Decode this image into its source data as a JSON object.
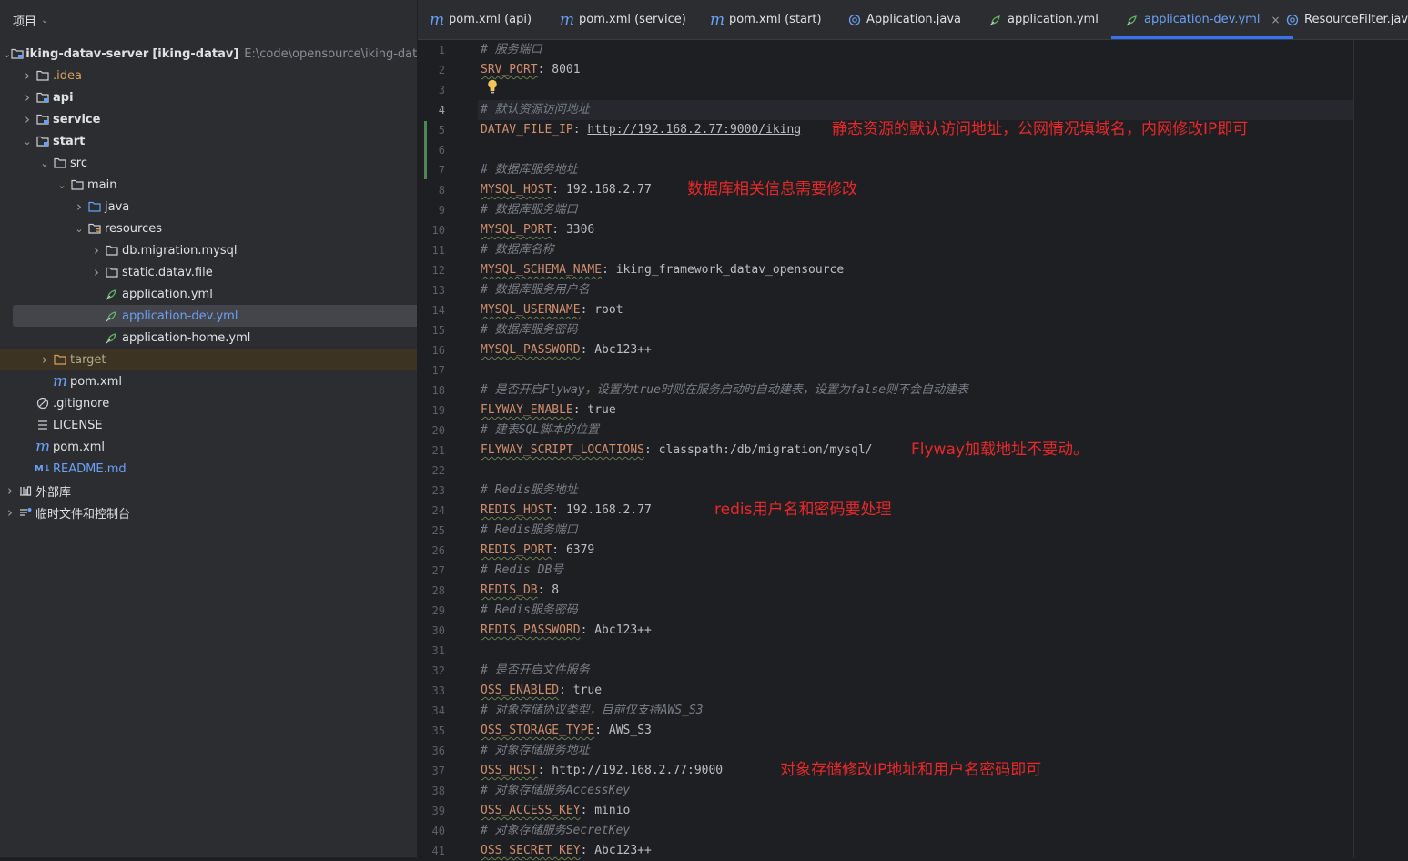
{
  "project_panel": {
    "title": "项目",
    "tree": [
      {
        "label": "iking-datav-server",
        "tag": "[iking-datav]",
        "path": "E:\\code\\opensource\\iking-datav-serv",
        "icon": "module-folder-icon",
        "depth": 0,
        "arrow": "v",
        "style": "",
        "name": "root"
      },
      {
        "label": ".idea",
        "icon": "folder-icon",
        "depth": 1,
        "arrow": ">",
        "style": "orange",
        "name": "idea"
      },
      {
        "label": "api",
        "icon": "module-folder-icon",
        "depth": 1,
        "arrow": ">",
        "style": "bold",
        "name": "api"
      },
      {
        "label": "service",
        "icon": "module-folder-icon",
        "depth": 1,
        "arrow": ">",
        "style": "bold",
        "name": "service"
      },
      {
        "label": "start",
        "icon": "module-folder-icon",
        "depth": 1,
        "arrow": "v",
        "style": "bold",
        "name": "start"
      },
      {
        "label": "src",
        "icon": "folder-icon",
        "depth": 2,
        "arrow": "v",
        "style": "",
        "name": "src"
      },
      {
        "label": "main",
        "icon": "folder-icon",
        "depth": 3,
        "arrow": "v",
        "style": "",
        "name": "main"
      },
      {
        "label": "java",
        "icon": "source-folder-icon",
        "depth": 4,
        "arrow": ">",
        "style": "",
        "name": "java"
      },
      {
        "label": "resources",
        "icon": "resources-folder-icon",
        "depth": 4,
        "arrow": "v",
        "style": "",
        "name": "resources"
      },
      {
        "label": "db.migration.mysql",
        "icon": "folder-icon",
        "depth": 5,
        "arrow": ">",
        "style": "",
        "name": "db-migration"
      },
      {
        "label": "static.datav.file",
        "icon": "folder-icon",
        "depth": 5,
        "arrow": ">",
        "style": "",
        "name": "static-datav"
      },
      {
        "label": "application.yml",
        "icon": "yaml-file-icon",
        "depth": 5,
        "arrow": "",
        "style": "",
        "name": "application-yml"
      },
      {
        "label": "application-dev.yml",
        "icon": "yaml-file-icon",
        "depth": 5,
        "arrow": "",
        "style": "blue",
        "selected": true,
        "name": "application-dev-yml"
      },
      {
        "label": "application-home.yml",
        "icon": "yaml-file-icon",
        "depth": 5,
        "arrow": "",
        "style": "",
        "name": "application-home-yml"
      },
      {
        "label": "target",
        "icon": "excluded-folder-icon",
        "depth": 2,
        "arrow": ">",
        "style": "tan",
        "excluded": true,
        "name": "target"
      },
      {
        "label": "pom.xml",
        "icon": "maven-icon",
        "depth": 2,
        "arrow": "",
        "style": "",
        "name": "start-pom"
      },
      {
        "label": ".gitignore",
        "icon": "ignore-file-icon",
        "depth": 1,
        "arrow": "",
        "style": "",
        "name": "gitignore"
      },
      {
        "label": "LICENSE",
        "icon": "text-file-icon",
        "depth": 1,
        "arrow": "",
        "style": "",
        "name": "license"
      },
      {
        "label": "pom.xml",
        "icon": "maven-icon",
        "depth": 1,
        "arrow": "",
        "style": "",
        "name": "root-pom"
      },
      {
        "label": "README.md",
        "icon": "markdown-icon",
        "depth": 1,
        "arrow": "",
        "style": "blue",
        "name": "readme"
      },
      {
        "label": "外部库",
        "icon": "library-icon",
        "depth": 0,
        "arrow": ">",
        "style": "",
        "name": "external-libraries"
      },
      {
        "label": "临时文件和控制台",
        "icon": "scratches-icon",
        "depth": 0,
        "arrow": ">",
        "style": "",
        "name": "scratches"
      }
    ]
  },
  "tabs": [
    {
      "label": "pom.xml (api)",
      "icon": "maven-icon",
      "glyph": "m",
      "active": false
    },
    {
      "label": "pom.xml (service)",
      "icon": "maven-icon",
      "glyph": "m",
      "active": false
    },
    {
      "label": "pom.xml (start)",
      "icon": "maven-icon",
      "glyph": "m",
      "active": false
    },
    {
      "label": "Application.java",
      "icon": "java-class-icon",
      "glyph": "◎",
      "active": false
    },
    {
      "label": "application.yml",
      "icon": "yaml-file-icon",
      "glyph": "",
      "active": false
    },
    {
      "label": "application-dev.yml",
      "icon": "yaml-file-icon",
      "glyph": "",
      "active": true,
      "closable": true
    },
    {
      "label": "ResourceFilter.java",
      "icon": "java-class-icon",
      "glyph": "◎",
      "active": false
    }
  ],
  "editor": {
    "current_line": 4,
    "lines": [
      {
        "n": "1",
        "type": "comment",
        "text": "# 服务端口"
      },
      {
        "n": "2",
        "type": "kv",
        "key": "SRV_PORT",
        "value": "8001"
      },
      {
        "n": "3",
        "type": "blank"
      },
      {
        "n": "4",
        "type": "comment",
        "text": "# 默认资源访问地址"
      },
      {
        "n": "5",
        "type": "kv",
        "key": "DATAV_FILE_IP",
        "value": "http://192.168.2.77:9000/iking",
        "url": true,
        "plainkey": true
      },
      {
        "n": "6",
        "type": "blank"
      },
      {
        "n": "7",
        "type": "comment",
        "text": "# 数据库服务地址"
      },
      {
        "n": "8",
        "type": "kv",
        "key": "MYSQL_HOST",
        "value": "192.168.2.77"
      },
      {
        "n": "9",
        "type": "comment",
        "text": "# 数据库服务端口"
      },
      {
        "n": "10",
        "type": "kv",
        "key": "MYSQL_PORT",
        "value": "3306"
      },
      {
        "n": "11",
        "type": "comment",
        "text": "# 数据库名称"
      },
      {
        "n": "12",
        "type": "kv",
        "key": "MYSQL_SCHEMA_NAME",
        "value": "iking_framework_datav_opensource"
      },
      {
        "n": "13",
        "type": "comment",
        "text": "# 数据库服务用户名"
      },
      {
        "n": "14",
        "type": "kv",
        "key": "MYSQL_USERNAME",
        "value": "root"
      },
      {
        "n": "15",
        "type": "comment",
        "text": "# 数据库服务密码"
      },
      {
        "n": "16",
        "type": "kv",
        "key": "MYSQL_PASSWORD",
        "value": "Abc123++"
      },
      {
        "n": "17",
        "type": "blank"
      },
      {
        "n": "18",
        "type": "comment",
        "text": "# 是否开启Flyway，设置为true时则在服务启动时自动建表，设置为false则不会自动建表"
      },
      {
        "n": "19",
        "type": "kv",
        "key": "FLYWAY_ENABLE",
        "value": "true"
      },
      {
        "n": "20",
        "type": "comment",
        "text": "# 建表SQL脚本的位置"
      },
      {
        "n": "21",
        "type": "kv",
        "key": "FLYWAY_SCRIPT_LOCATIONS",
        "value": "classpath:/db/migration/mysql/"
      },
      {
        "n": "22",
        "type": "blank"
      },
      {
        "n": "23",
        "type": "comment",
        "text": "# Redis服务地址"
      },
      {
        "n": "24",
        "type": "kv",
        "key": "REDIS_HOST",
        "value": "192.168.2.77"
      },
      {
        "n": "25",
        "type": "comment",
        "text": "# Redis服务端口"
      },
      {
        "n": "26",
        "type": "kv",
        "key": "REDIS_PORT",
        "value": "6379"
      },
      {
        "n": "27",
        "type": "comment",
        "text": "# Redis DB号"
      },
      {
        "n": "28",
        "type": "kv",
        "key": "REDIS_DB",
        "value": "8"
      },
      {
        "n": "29",
        "type": "comment",
        "text": "# Redis服务密码"
      },
      {
        "n": "30",
        "type": "kv",
        "key": "REDIS_PASSWORD",
        "value": "Abc123++"
      },
      {
        "n": "31",
        "type": "blank"
      },
      {
        "n": "32",
        "type": "comment",
        "text": "# 是否开启文件服务"
      },
      {
        "n": "33",
        "type": "kv",
        "key": "OSS_ENABLED",
        "value": "true"
      },
      {
        "n": "34",
        "type": "comment",
        "text": "# 对象存储协议类型，目前仅支持AWS_S3"
      },
      {
        "n": "35",
        "type": "kv",
        "key": "OSS_STORAGE_TYPE",
        "value": "AWS_S3"
      },
      {
        "n": "36",
        "type": "comment",
        "text": "# 对象存储服务地址"
      },
      {
        "n": "37",
        "type": "kv",
        "key": "OSS_HOST",
        "value": "http://192.168.2.77:9000",
        "url": true
      },
      {
        "n": "38",
        "type": "comment",
        "text": "# 对象存储服务AccessKey"
      },
      {
        "n": "39",
        "type": "kv",
        "key": "OSS_ACCESS_KEY",
        "value": "minio"
      },
      {
        "n": "40",
        "type": "comment",
        "text": "# 对象存储服务SecretKey"
      },
      {
        "n": "41",
        "type": "kv",
        "key": "OSS_SECRET_KEY",
        "value": "Abc123++"
      }
    ]
  },
  "annotations": [
    {
      "text": "静态资源的默认访问地址，公网情况填域名，内网修改IP即可",
      "line": 5,
      "col": 389
    },
    {
      "text": "数据库相关信息需要修改",
      "line": 8,
      "col": 230
    },
    {
      "text": "Flyway加载地址不要动。",
      "line": 21,
      "col": 476
    },
    {
      "text": "redis用户名和密码要处理",
      "line": 24,
      "col": 260
    },
    {
      "text": "对象存储修改IP地址和用户名密码即可",
      "line": 37,
      "col": 332
    }
  ],
  "colors": {
    "annotation": "#e8282b",
    "key": "#cf8e6d",
    "comment": "#7a7e85",
    "accent": "#3574f0"
  }
}
